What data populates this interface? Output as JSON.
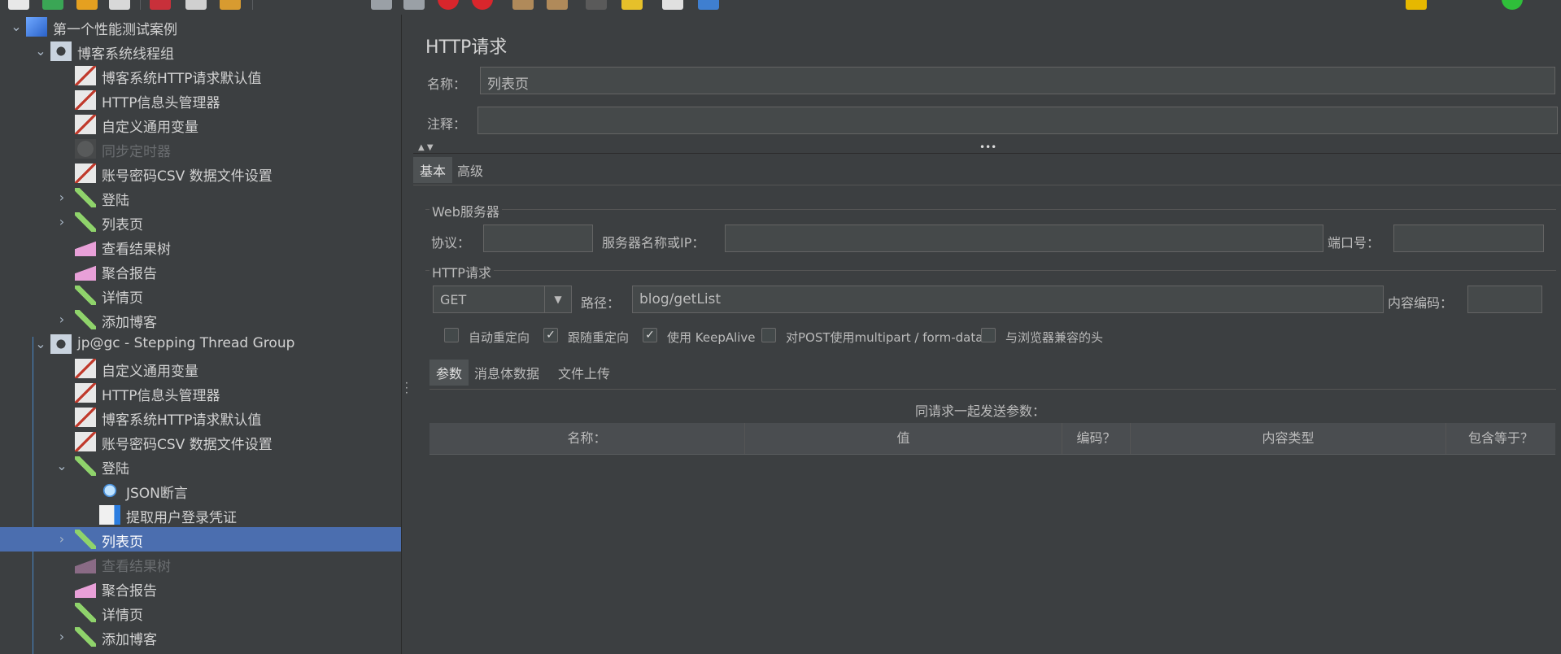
{
  "tree": {
    "items": [
      {
        "label": "第一个性能测试案例",
        "icon": "test-plan-icon",
        "toggle": "down"
      },
      {
        "label": "博客系统线程组",
        "icon": "gear-icon",
        "toggle": "down"
      },
      {
        "label": "博客系统HTTP请求默认值",
        "icon": "config-tools-icon",
        "toggle": ""
      },
      {
        "label": "HTTP信息头管理器",
        "icon": "config-tools-icon",
        "toggle": ""
      },
      {
        "label": "自定义通用变量",
        "icon": "config-tools-icon",
        "toggle": ""
      },
      {
        "label": "同步定时器",
        "icon": "timer-icon",
        "toggle": "",
        "disabled": true
      },
      {
        "label": "账号密码CSV 数据文件设置",
        "icon": "config-tools-icon",
        "toggle": ""
      },
      {
        "label": "登陆",
        "icon": "sampler-pipette-icon",
        "toggle": "right"
      },
      {
        "label": "列表页",
        "icon": "sampler-pipette-icon",
        "toggle": "right"
      },
      {
        "label": "查看结果树",
        "icon": "listener-chart-icon",
        "toggle": ""
      },
      {
        "label": "聚合报告",
        "icon": "listener-chart-icon",
        "toggle": ""
      },
      {
        "label": "详情页",
        "icon": "sampler-pipette-icon",
        "toggle": ""
      },
      {
        "label": "添加博客",
        "icon": "sampler-pipette-icon",
        "toggle": "right"
      },
      {
        "label": "jp@gc - Stepping Thread Group",
        "icon": "gear-icon",
        "toggle": "down"
      },
      {
        "label": "自定义通用变量",
        "icon": "config-tools-icon",
        "toggle": ""
      },
      {
        "label": "HTTP信息头管理器",
        "icon": "config-tools-icon",
        "toggle": ""
      },
      {
        "label": "博客系统HTTP请求默认值",
        "icon": "config-tools-icon",
        "toggle": ""
      },
      {
        "label": "账号密码CSV 数据文件设置",
        "icon": "config-tools-icon",
        "toggle": ""
      },
      {
        "label": "登陆",
        "icon": "sampler-pipette-icon",
        "toggle": "down"
      },
      {
        "label": "JSON断言",
        "icon": "assertion-magnifier-icon",
        "toggle": ""
      },
      {
        "label": "提取用户登录凭证",
        "icon": "extractor-icon",
        "toggle": ""
      },
      {
        "label": "列表页",
        "icon": "sampler-pipette-icon",
        "toggle": "right",
        "selected": true
      },
      {
        "label": "查看结果树",
        "icon": "listener-chart-icon",
        "toggle": "",
        "disabled": true
      },
      {
        "label": "聚合报告",
        "icon": "listener-chart-icon",
        "toggle": ""
      },
      {
        "label": "详情页",
        "icon": "sampler-pipette-icon",
        "toggle": ""
      },
      {
        "label": "添加博客",
        "icon": "sampler-pipette-icon",
        "toggle": "right"
      }
    ]
  },
  "panel": {
    "title": "HTTP请求",
    "name_label": "名称：",
    "name_value": "列表页",
    "comment_label": "注释：",
    "comment_value": "",
    "tabs": [
      "基本",
      "高级"
    ],
    "web_server": {
      "title": "Web服务器",
      "protocol_label": "协议：",
      "protocol_value": "",
      "server_label": "服务器名称或IP：",
      "server_value": "",
      "port_label": "端口号：",
      "port_value": ""
    },
    "http_request": {
      "title": "HTTP请求",
      "method": "GET",
      "path_label": "路径：",
      "path_value": "blog/getList",
      "encoding_label": "内容编码：",
      "encoding_value": ""
    },
    "options": [
      {
        "label": "自动重定向",
        "checked": false
      },
      {
        "label": "跟随重定向",
        "checked": true
      },
      {
        "label": "使用 KeepAlive",
        "checked": true
      },
      {
        "label": "对POST使用multipart / form-data",
        "checked": false
      },
      {
        "label": "与浏览器兼容的头",
        "checked": false
      }
    ],
    "sub_tabs": [
      "参数",
      "消息体数据",
      "文件上传"
    ],
    "params_caption": "同请求一起发送参数：",
    "table_headers": [
      "名称：",
      "值",
      "编码？",
      "内容类型",
      "包含等于？"
    ]
  },
  "colors": {
    "background": "#3c3f41",
    "selection": "#4b6eaf",
    "field": "#45494a"
  }
}
